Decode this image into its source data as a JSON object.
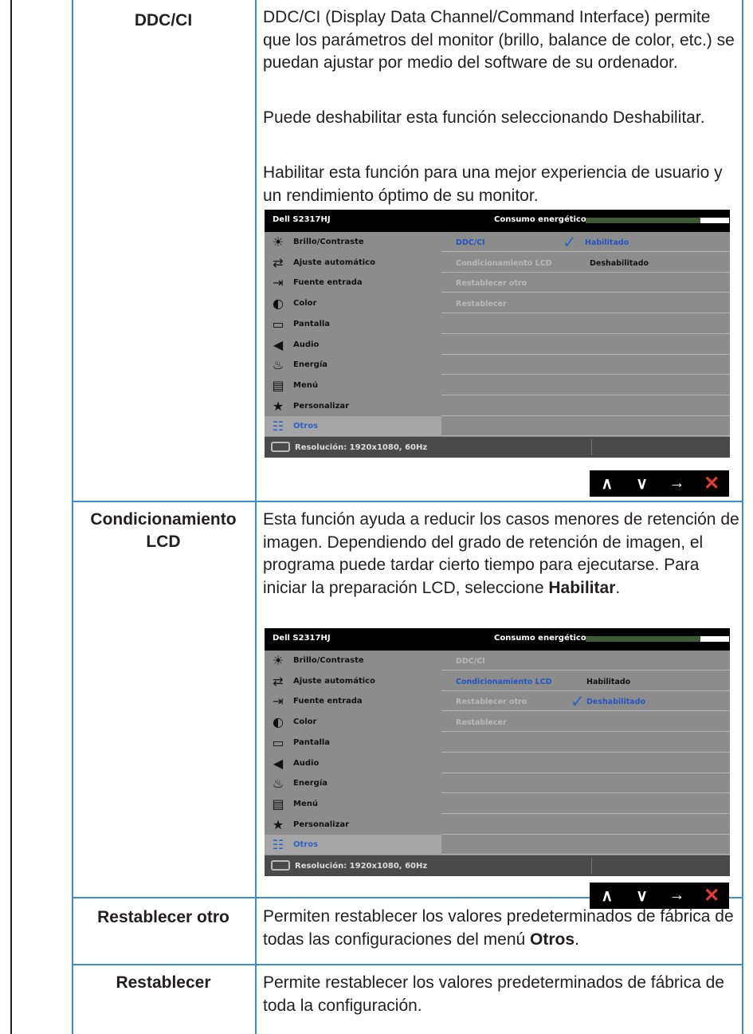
{
  "sections": [
    {
      "label": "DDC/CI",
      "paragraphs": [
        "DDC/CI (Display Data Channel/Command Interface) permite que los parámetros del monitor (brillo, balance de color, etc.) se puedan ajustar por medio del software de su ordenador.",
        "Puede deshabilitar esta función seleccionando Deshabilitar.",
        "Habilitar esta función para una mejor experiencia de usuario y un rendimiento óptimo de su monitor."
      ]
    },
    {
      "label_line1": "Condicionamiento",
      "label_line2": "LCD",
      "paragraph_pre": "Esta función ayuda a reducir los casos menores de retención de imagen. Dependiendo del grado de retención de imagen, el programa puede tardar cierto tiempo para ejecutarse. Para iniciar la preparación LCD, seleccione ",
      "paragraph_bold": "Habilitar",
      "paragraph_post": "."
    },
    {
      "label": "Restablecer otro",
      "paragraph_pre": "Permiten restablecer los valores predeterminados de fábrica de todas las configuraciones del menú ",
      "paragraph_bold": "Otros",
      "paragraph_post": "."
    },
    {
      "label": "Restablecer",
      "paragraph": "Permite restablecer los valores predeterminados de fábrica de toda la configuración."
    }
  ],
  "osd": {
    "title": "Dell S2317HJ",
    "energy_label": "Consumo energético",
    "energy_level": 0.8,
    "menu": [
      {
        "label": "Brillo/Contraste",
        "icon": "brightness-icon"
      },
      {
        "label": "Ajuste automático",
        "icon": "auto-adjust-icon"
      },
      {
        "label": "Fuente entrada",
        "icon": "input-source-icon"
      },
      {
        "label": "Color",
        "icon": "color-icon"
      },
      {
        "label": "Pantalla",
        "icon": "display-icon"
      },
      {
        "label": "Audio",
        "icon": "audio-icon"
      },
      {
        "label": "Energía",
        "icon": "energy-icon"
      },
      {
        "label": "Menú",
        "icon": "menu-icon"
      },
      {
        "label": "Personalizar",
        "icon": "star-icon"
      },
      {
        "label": "Otros",
        "icon": "others-icon"
      }
    ],
    "resolution": "Resolución: 1920x1080, 60Hz",
    "osd1_rows": [
      {
        "key": "DDC/CI",
        "value": "Habilitado",
        "checked": true
      },
      {
        "key": "Condicionamiento LCD",
        "value": "Deshabilitado"
      },
      {
        "key": "Restablecer otro",
        "value": ""
      },
      {
        "key": "Restablecer",
        "value": ""
      }
    ],
    "osd2_rows": [
      {
        "key": "DDC/CI",
        "value": ""
      },
      {
        "key": "Condicionamiento LCD",
        "value": "Habilitado"
      },
      {
        "key": "Restablecer otro",
        "value": "Deshabilitado",
        "checked": true
      },
      {
        "key": "Restablecer",
        "value": ""
      }
    ]
  },
  "nav_buttons": {
    "up": "∧",
    "down": "∨",
    "enter": "→",
    "exit": "✕"
  }
}
